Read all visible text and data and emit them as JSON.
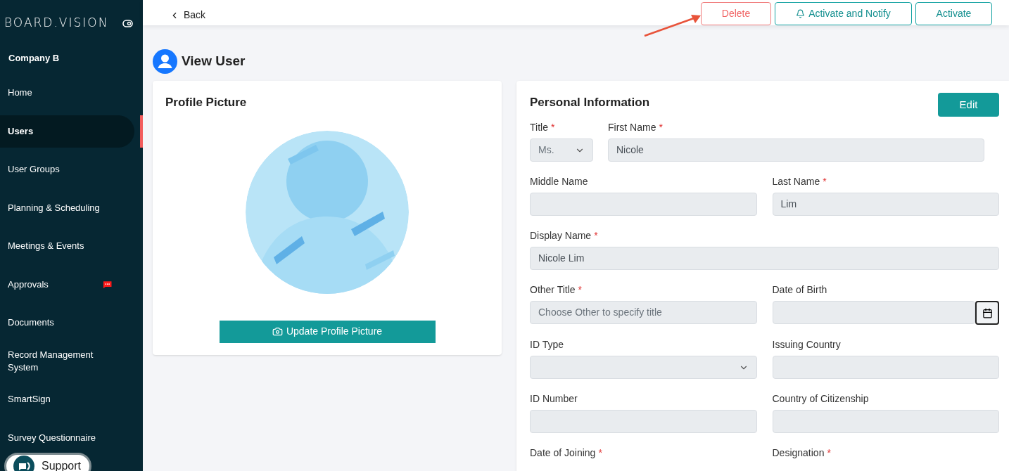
{
  "brand": "BOARD.VISION",
  "company": "Company B",
  "sidebar": {
    "items": [
      {
        "label": "Home",
        "selected": false
      },
      {
        "label": "Users",
        "selected": true
      },
      {
        "label": "User Groups",
        "selected": false
      },
      {
        "label": "Planning & Scheduling",
        "selected": false
      },
      {
        "label": "Meetings & Events",
        "selected": false
      },
      {
        "label": "Approvals",
        "selected": false,
        "badge": true
      },
      {
        "label": "Documents",
        "selected": false
      },
      {
        "label": "Record Management System",
        "selected": false
      },
      {
        "label": "SmartSign",
        "selected": false
      },
      {
        "label": "Survey Questionnaire",
        "selected": false
      }
    ]
  },
  "support": "Support",
  "topbar": {
    "back": "Back",
    "buttons": [
      {
        "label": "Delete",
        "kind": "danger"
      },
      {
        "label": "Activate and Notify",
        "kind": "notify"
      },
      {
        "label": "Activate",
        "kind": "outline"
      }
    ]
  },
  "page_title": "View User",
  "profile_card": {
    "title": "Profile Picture",
    "button": "Update Profile Picture"
  },
  "personal_info": {
    "title": "Personal Information",
    "edit": "Edit",
    "rows": [
      {
        "kind": "title",
        "fields": [
          {
            "label": "Title",
            "mark": "*",
            "kind": "select",
            "value": "Ms."
          },
          {
            "label": "First Name",
            "mark": "*",
            "kind": "text",
            "value": "Nicole"
          }
        ]
      },
      {
        "kind": "half",
        "fields": [
          {
            "label": "Middle Name",
            "kind": "text"
          },
          {
            "label": "Last Name",
            "mark": "*",
            "kind": "text",
            "value": "Lim"
          }
        ]
      },
      {
        "kind": "full",
        "fields": [
          {
            "label": "Display Name",
            "mark": "*",
            "kind": "text",
            "value": "Nicole Lim"
          }
        ]
      },
      {
        "kind": "half",
        "fields": [
          {
            "label": "Other Title",
            "mark": "*",
            "kind": "text",
            "placeholder": "Choose Other to specify title"
          },
          {
            "label": "Date of Birth",
            "kind": "date"
          }
        ]
      },
      {
        "kind": "half",
        "fields": [
          {
            "label": "ID Type",
            "kind": "select"
          },
          {
            "label": "Issuing Country",
            "kind": "text"
          }
        ]
      },
      {
        "kind": "half",
        "fields": [
          {
            "label": "ID Number",
            "kind": "text"
          },
          {
            "label": "Country of Citizenship",
            "kind": "text"
          }
        ]
      },
      {
        "kind": "half",
        "fields": [
          {
            "label": "Date of Joining",
            "mark": "*",
            "kind": "label"
          },
          {
            "label": "Designation",
            "mark": "*",
            "kind": "label"
          }
        ]
      }
    ]
  }
}
